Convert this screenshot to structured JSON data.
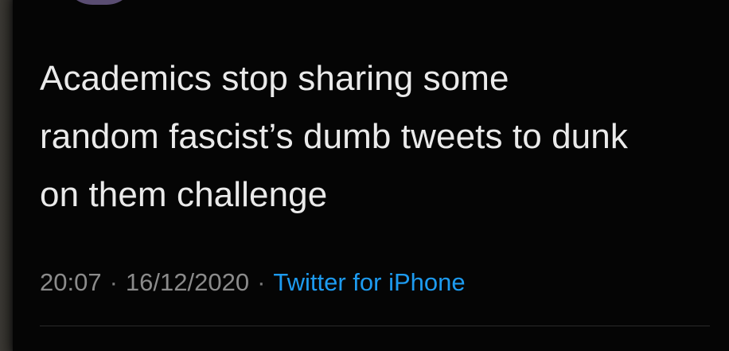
{
  "tweet": {
    "text": "Academics stop sharing some\nrandom fascist’s dumb tweets to dunk\non them challenge",
    "time": "20:07",
    "date": "16/12/2020",
    "separator": "·",
    "source": "Twitter for iPhone"
  },
  "colors": {
    "background": "#050505",
    "text": "#eaeaea",
    "meta": "#8b8b8b",
    "link": "#1d9bf0"
  }
}
